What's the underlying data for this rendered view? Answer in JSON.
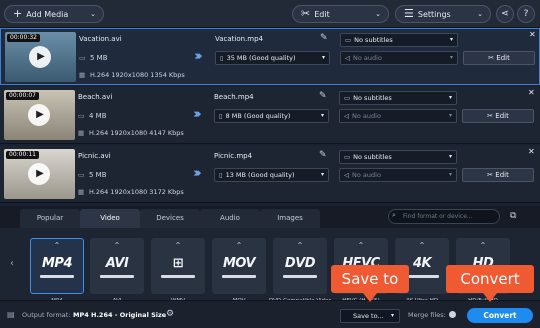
{
  "toolbar": {
    "add_media": "Add Media",
    "edit": "Edit",
    "settings": "Settings"
  },
  "files": [
    {
      "duration": "00:00:32",
      "name": "Vacation.avi",
      "size": "5 MB",
      "info": "H.264 1920x1080 1354 Kbps",
      "output_name": "Vacation.mp4",
      "output_size": "35 MB (Good quality)",
      "subtitles": "No subtitles",
      "audio": "No audio",
      "edit": "Edit",
      "thumb_colors": [
        "#6b8fa8",
        "#3a5a70"
      ]
    },
    {
      "duration": "00:00:07",
      "name": "Beach.avi",
      "size": "4 MB",
      "info": "H.264 1920x1080 4147 Kbps",
      "output_name": "Beach.mp4",
      "output_size": "8 MB (Good quality)",
      "subtitles": "No subtitles",
      "audio": "No audio",
      "edit": "Edit",
      "thumb_colors": [
        "#c9c3b4",
        "#8a8577"
      ]
    },
    {
      "duration": "00:00:11",
      "name": "Picnic.avi",
      "size": "5 MB",
      "info": "H.264 1920x1080 3172 Kbps",
      "output_name": "Picnic.mp4",
      "output_size": "13 MB (Good quality)",
      "subtitles": "No subtitles",
      "audio": "No audio",
      "edit": "Edit",
      "thumb_colors": [
        "#d9d6cf",
        "#9c978c"
      ]
    }
  ],
  "tabs": [
    "Popular",
    "Video",
    "Devices",
    "Audio",
    "Images"
  ],
  "active_tab": "Video",
  "search_placeholder": "Find format or device...",
  "formats": [
    {
      "logo": "MP4",
      "label": "MP4"
    },
    {
      "logo": "AVI",
      "label": "AVI"
    },
    {
      "logo": "⊞",
      "label": "WMV"
    },
    {
      "logo": "MOV",
      "label": "MOV"
    },
    {
      "logo": "DVD",
      "label": "DVD-Compatible Video"
    },
    {
      "logo": "HEVC",
      "label": "HEVC (H.265)"
    },
    {
      "logo": "4K",
      "label": "4K Ultra HD"
    },
    {
      "logo": "HD",
      "label": "HD/Full HD"
    }
  ],
  "footer": {
    "output_format_label": "Output format:",
    "output_format_value": "MP4 H.264 - Original Size",
    "save_to": "Save to...",
    "merge_files": "Merge files:",
    "convert": "Convert"
  },
  "callouts": {
    "save_to": "Save to",
    "convert": "Convert"
  },
  "colors": {
    "accent": "#1e8bf0",
    "callout": "#f05a33",
    "selection": "#3c7fd3"
  }
}
